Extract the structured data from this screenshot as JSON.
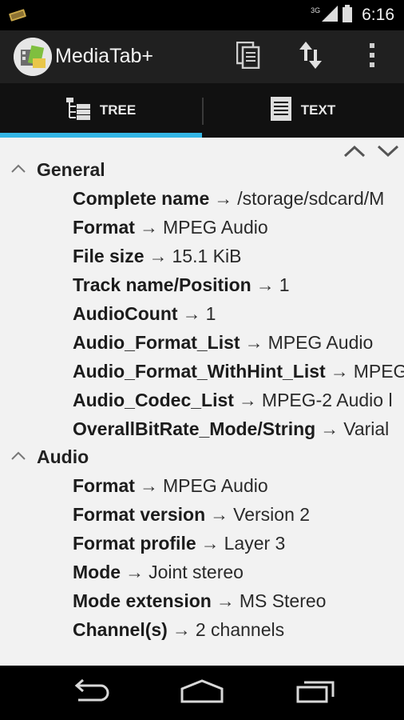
{
  "status_bar": {
    "network_label": "3G",
    "time": "6:16"
  },
  "action_bar": {
    "title": "MediaTab+"
  },
  "tabs": [
    {
      "label": "TREE",
      "selected": true
    },
    {
      "label": "TEXT",
      "selected": false
    }
  ],
  "sections": [
    {
      "title": "General",
      "rows": [
        {
          "key": "Complete name",
          "value": "/storage/sdcard/M"
        },
        {
          "key": "Format",
          "value": "MPEG Audio"
        },
        {
          "key": "File size",
          "value": "15.1 KiB"
        },
        {
          "key": "Track name/Position",
          "value": "1"
        },
        {
          "key": "AudioCount",
          "value": "1"
        },
        {
          "key": "Audio_Format_List",
          "value": "MPEG Audio"
        },
        {
          "key": "Audio_Format_WithHint_List",
          "value": "MPEG"
        },
        {
          "key": "Audio_Codec_List",
          "value": "MPEG-2 Audio l"
        },
        {
          "key": "OverallBitRate_Mode/String",
          "value": "Varial"
        }
      ]
    },
    {
      "title": "Audio",
      "rows": [
        {
          "key": "Format",
          "value": "MPEG Audio"
        },
        {
          "key": "Format version",
          "value": "Version 2"
        },
        {
          "key": "Format profile",
          "value": "Layer 3"
        },
        {
          "key": "Mode",
          "value": "Joint stereo"
        },
        {
          "key": "Mode extension",
          "value": "MS Stereo"
        },
        {
          "key": "Channel(s)",
          "value": "2 channels"
        }
      ]
    }
  ],
  "separator": "→",
  "colors": {
    "accent": "#33b5e5",
    "action_bar": "#202020",
    "content_bg": "#f2f2f2"
  }
}
